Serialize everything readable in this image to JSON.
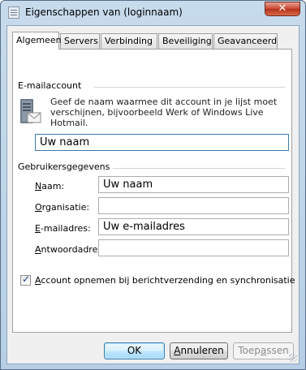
{
  "window": {
    "title": "Eigenschappen van (loginnaam)",
    "close_label": "✕"
  },
  "tabs": [
    {
      "label": "Algemeen",
      "active": true
    },
    {
      "label": "Servers",
      "active": false
    },
    {
      "label": "Verbinding",
      "active": false
    },
    {
      "label": "Beveiliging",
      "active": false
    },
    {
      "label": "Geavanceerd",
      "active": false
    }
  ],
  "email_account": {
    "heading": "E-mailaccount",
    "description": "Geef de naam waarmee dit account in je lijst moet verschijnen, bijvoorbeeld Werk of Windows Live Hotmail.",
    "account_name_value": "Uw naam"
  },
  "user_info": {
    "heading": "Gebruikersgegevens",
    "name_label": "Naam:",
    "name_value": "Uw naam",
    "organization_label": "Organisatie:",
    "organization_value": "",
    "email_label": "E-mailadres:",
    "email_value": "Uw e-mailadres",
    "reply_label": "Antwoordadres:",
    "reply_value": ""
  },
  "options": {
    "include_account_label": "Account opnemen bij berichtverzending en synchronisatie",
    "include_account_checked": true
  },
  "buttons": {
    "ok": "OK",
    "cancel": "Annuleren",
    "apply": "Toepassen"
  }
}
